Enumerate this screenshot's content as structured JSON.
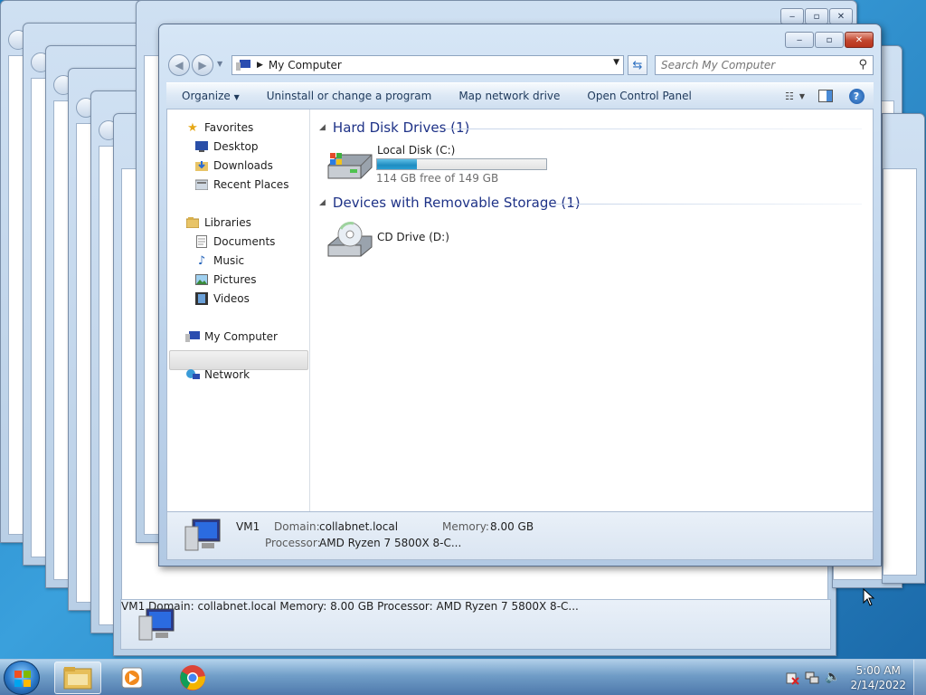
{
  "window": {
    "title_path": "My Computer",
    "search_placeholder": "Search My Computer"
  },
  "toolbar": {
    "organize": "Organize",
    "uninstall": "Uninstall or change a program",
    "map_drive": "Map network drive",
    "control_panel": "Open Control Panel"
  },
  "nav": {
    "favorites": "Favorites",
    "desktop": "Desktop",
    "downloads": "Downloads",
    "recent": "Recent Places",
    "libraries": "Libraries",
    "documents": "Documents",
    "music": "Music",
    "pictures": "Pictures",
    "videos": "Videos",
    "computer": "My Computer",
    "network": "Network"
  },
  "content": {
    "hdd_header": "Hard Disk Drives (1)",
    "removable_header": "Devices with Removable Storage (1)",
    "local_disk": {
      "name": "Local Disk (C:)",
      "free_text": "114 GB free of 149 GB",
      "used_fraction": 0.235
    },
    "cd_drive": {
      "name": "CD Drive (D:)"
    }
  },
  "details": {
    "name": "VM1",
    "domain_label": "Domain:",
    "domain": "collabnet.local",
    "memory_label": "Memory:",
    "memory": "8.00 GB",
    "processor_label": "Processor:",
    "processor": "AMD Ryzen 7 5800X 8-C..."
  },
  "clock": {
    "time": "5:00 AM",
    "date": "2/14/2022"
  }
}
